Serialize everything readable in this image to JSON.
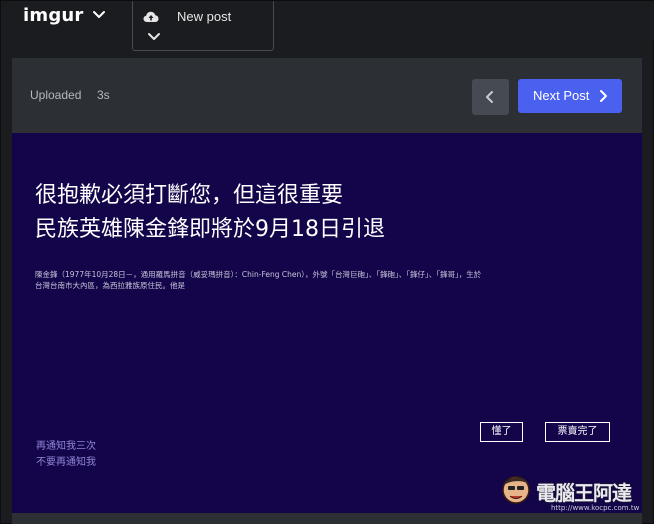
{
  "topbar": {
    "logo": "imgur",
    "new_post_label": "New post"
  },
  "post_header": {
    "uploaded_label": "Uploaded",
    "age": "3s",
    "next_label": "Next Post"
  },
  "image": {
    "headline_lines": [
      "很抱歉必須打斷您，但這很重要",
      "民族英雄陳金鋒即將於9月18日引退"
    ],
    "body_lines": [
      "陳金鋒（1977年10月28日－，通用羅馬拼音（威妥瑪拼音）：Chin-Feng Chen），外號「台灣巨砲」、「鋒砲」、「鋒仔」、「鋒哥」，生於",
      "台灣台南市大內區，為西拉雅族原住民。他是"
    ],
    "remind_again": "再通知我三次",
    "dont_remind": "不要再通知我",
    "ok_button": "懂了",
    "sold_out_button": "票賣完了"
  },
  "watermark": {
    "name": "電腦王阿達",
    "url": "http://www.kocpc.com.tw"
  },
  "colors": {
    "accent": "#4a61f0",
    "image_bg": "#14054a",
    "page_bg": "#1b1c1f",
    "panel_bg": "#2c2f34"
  },
  "icons": [
    "chevron-down-icon",
    "cloud-upload-icon",
    "chevron-left-icon",
    "chevron-right-icon"
  ]
}
